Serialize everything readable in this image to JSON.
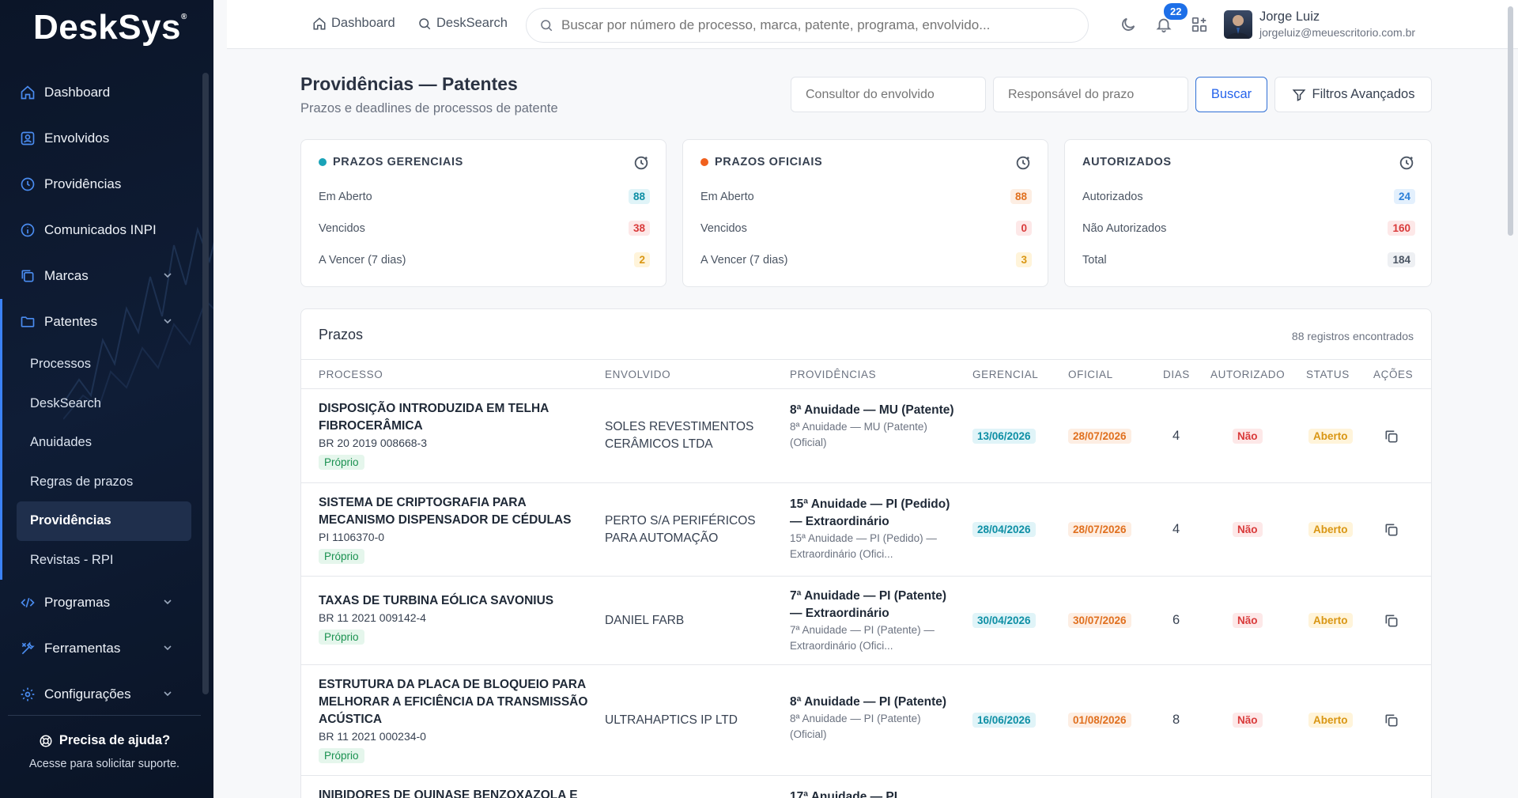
{
  "app": {
    "logo": "DeskSys",
    "logo_mark": "®"
  },
  "sidebar": {
    "items": [
      {
        "label": "Dashboard",
        "icon": "home-icon"
      },
      {
        "label": "Envolvidos",
        "icon": "users-icon"
      },
      {
        "label": "Providências",
        "icon": "clock-icon"
      },
      {
        "label": "Comunicados INPI",
        "icon": "info-icon"
      },
      {
        "label": "Marcas",
        "icon": "copy-icon"
      },
      {
        "label": "Patentes",
        "icon": "folder-icon"
      },
      {
        "label": "Programas",
        "icon": "code-icon"
      },
      {
        "label": "Ferramentas",
        "icon": "tools-icon"
      },
      {
        "label": "Configurações",
        "icon": "gear-icon"
      }
    ],
    "patentes_sub": [
      {
        "label": "Processos"
      },
      {
        "label": "DeskSearch"
      },
      {
        "label": "Anuidades"
      },
      {
        "label": "Regras de prazos"
      },
      {
        "label": "Providências"
      },
      {
        "label": "Revistas - RPI"
      }
    ],
    "help_title": "Precisa de ajuda?",
    "help_text": "Acesse para solicitar suporte."
  },
  "topbar": {
    "dashboard_link": "Dashboard",
    "desksearch_link": "DeskSearch",
    "search_placeholder": "Buscar por número de processo, marca, patente, programa, envolvido...",
    "notifications_count": "22",
    "user_name": "Jorge Luiz",
    "user_email": "jorgeluiz@meuescritorio.com.br"
  },
  "page": {
    "title": "Providências — Patentes",
    "subtitle": "Prazos e deadlines de processos de patente",
    "consultor_placeholder": "Consultor do envolvido",
    "responsavel_placeholder": "Responsável do prazo",
    "buscar_label": "Buscar",
    "filtros_label": "Filtros Avançados"
  },
  "cards": [
    {
      "title": "PRAZOS GERENCIAIS",
      "dot_color": "#1aa3b8",
      "rows": [
        {
          "label": "Em Aberto",
          "value": "88"
        },
        {
          "label": "Vencidos",
          "value": "38"
        },
        {
          "label": "A Vencer (7 dias)",
          "value": "2"
        }
      ]
    },
    {
      "title": "PRAZOS OFICIAIS",
      "dot_color": "#f0601e",
      "rows": [
        {
          "label": "Em Aberto",
          "value": "88"
        },
        {
          "label": "Vencidos",
          "value": "0"
        },
        {
          "label": "A Vencer (7 dias)",
          "value": "3"
        }
      ]
    },
    {
      "title": "AUTORIZADOS",
      "rows": [
        {
          "label": "Autorizados",
          "value": "24"
        },
        {
          "label": "Não Autorizados",
          "value": "160"
        },
        {
          "label": "Total",
          "value": "184"
        }
      ]
    }
  ],
  "table": {
    "title": "Prazos",
    "count": "88 registros encontrados",
    "headers": [
      "PROCESSO",
      "ENVOLVIDO",
      "PROVIDÊNCIAS",
      "GERENCIAL",
      "OFICIAL",
      "DIAS",
      "AUTORIZADO",
      "STATUS",
      "AÇÕES"
    ],
    "rows": [
      {
        "title": "DISPOSIÇÃO INTRODUZIDA EM TELHA FIBROCERÂMICA",
        "number": "BR 20 2019 008668-3",
        "tag": "Próprio",
        "envolvido": "SOLES REVESTIMENTOS CERÂMICOS LTDA",
        "prov_title": "8ª Anuidade — MU (Patente)",
        "prov_sub": "8ª Anuidade — MU (Patente) (Oficial)",
        "gerencial": "13/06/2026",
        "oficial": "28/07/2026",
        "dias": "4",
        "autorizado": "Não",
        "status": "Aberto"
      },
      {
        "title": "SISTEMA DE CRIPTOGRAFIA PARA MECANISMO DISPENSADOR DE CÉDULAS",
        "number": "PI 1106370-0",
        "tag": "Próprio",
        "envolvido": "PERTO S/A PERIFÉRICOS PARA AUTOMAÇÃO",
        "prov_title": "15ª Anuidade — PI (Pedido) — Extraordinário",
        "prov_sub": "15ª Anuidade — PI (Pedido) — Extraordinário (Ofici...",
        "gerencial": "28/04/2026",
        "oficial": "28/07/2026",
        "dias": "4",
        "autorizado": "Não",
        "status": "Aberto"
      },
      {
        "title": "TAXAS DE TURBINA EÓLICA SAVONIUS",
        "number": "BR 11 2021 009142-4",
        "tag": "Próprio",
        "envolvido": "DANIEL FARB",
        "prov_title": "7ª Anuidade — PI (Patente) — Extraordinário",
        "prov_sub": "7ª Anuidade — PI (Patente) — Extraordinário (Ofici...",
        "gerencial": "30/04/2026",
        "oficial": "30/07/2026",
        "dias": "6",
        "autorizado": "Não",
        "status": "Aberto"
      },
      {
        "title": "ESTRUTURA DA PLACA DE BLOQUEIO PARA MELHORAR A EFICIÊNCIA DA TRANSMISSÃO ACÚSTICA",
        "number": "BR 11 2021 000234-0",
        "tag": "Próprio",
        "envolvido": "ULTRAHAPTICS IP LTD",
        "prov_title": "8ª Anuidade — PI (Patente)",
        "prov_sub": "8ª Anuidade — PI (Patente) (Oficial)",
        "gerencial": "16/06/2026",
        "oficial": "01/08/2026",
        "dias": "8",
        "autorizado": "Não",
        "status": "Aberto"
      },
      {
        "title": "INIBIDORES DE QUINASE BENZOXAZOLA E",
        "prov_title": "17ª Anuidade — PI"
      }
    ]
  }
}
